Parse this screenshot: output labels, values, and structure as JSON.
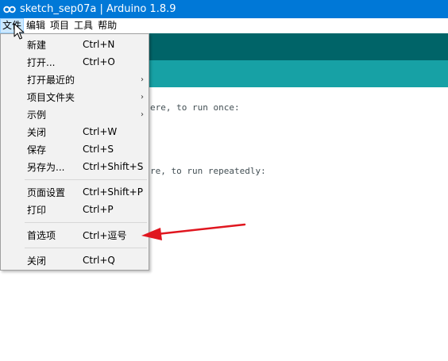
{
  "window": {
    "title": "sketch_sep07a | Arduino 1.8.9",
    "logo": "arduino-infinity-icon"
  },
  "menubar": {
    "items": [
      "文件",
      "编辑",
      "项目",
      "工具",
      "帮助"
    ],
    "active": "文件"
  },
  "editor": {
    "code_fragments": [
      "ere, to run once:",
      "re, to run repeatedly:"
    ]
  },
  "file_menu": {
    "items": [
      {
        "label": "新建",
        "shortcut": "Ctrl+N"
      },
      {
        "label": "打开...",
        "shortcut": "Ctrl+O"
      },
      {
        "label": "打开最近的",
        "submenu": true
      },
      {
        "label": "项目文件夹",
        "submenu": true
      },
      {
        "label": "示例",
        "submenu": true
      },
      {
        "label": "关闭",
        "shortcut": "Ctrl+W"
      },
      {
        "label": "保存",
        "shortcut": "Ctrl+S"
      },
      {
        "label": "另存为...",
        "shortcut": "Ctrl+Shift+S"
      },
      {
        "label": "页面设置",
        "shortcut": "Ctrl+Shift+P"
      },
      {
        "label": "打印",
        "shortcut": "Ctrl+P"
      },
      {
        "label": "首选项",
        "shortcut": "Ctrl+逗号"
      },
      {
        "label": "关闭",
        "shortcut": "Ctrl+Q"
      }
    ],
    "submenu_arrow": "›"
  },
  "colors": {
    "titlebar": "#0078d7",
    "toolbar": "#006468",
    "tabbar": "#17a1a5",
    "annotation_arrow": "#e0161f"
  }
}
